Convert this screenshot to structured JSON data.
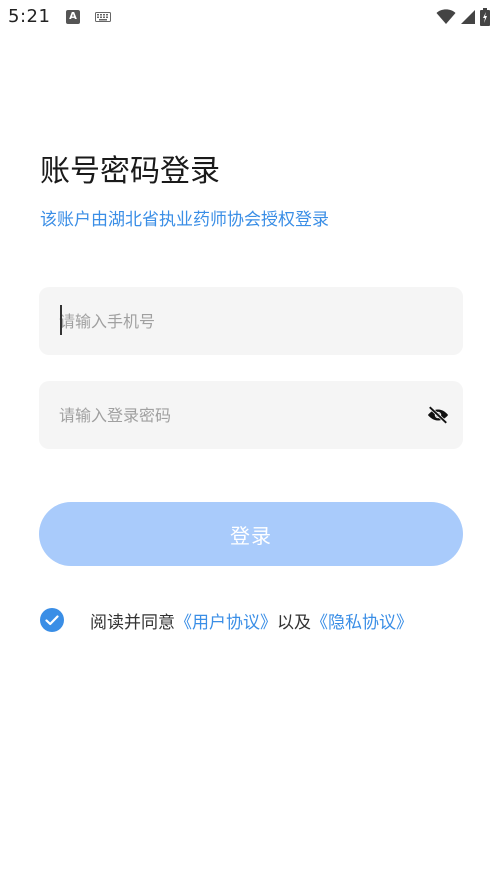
{
  "status_bar": {
    "time": "5:21",
    "left_icons": [
      "a-app-icon",
      "keyboard-icon"
    ],
    "right_icons": [
      "wifi-icon",
      "signal-icon",
      "battery-icon"
    ]
  },
  "login": {
    "title": "账号密码登录",
    "subtitle": "该账户由湖北省执业药师协会授权登录",
    "phone_field": {
      "value": "",
      "placeholder": "请输入手机号"
    },
    "password_field": {
      "value": "",
      "placeholder": "请输入登录密码",
      "visibility_icon": "eye-slash-icon"
    },
    "submit_label": "登录",
    "agreement": {
      "checked": true,
      "prefix": "阅读并同意",
      "user_agreement": "《用户协议》",
      "conjunction": "以及",
      "privacy_policy": "《隐私协议》"
    }
  },
  "colors": {
    "accent": "#3a8ee6",
    "button_disabled": "#a9cbfb",
    "field_bg": "#f5f5f5"
  }
}
